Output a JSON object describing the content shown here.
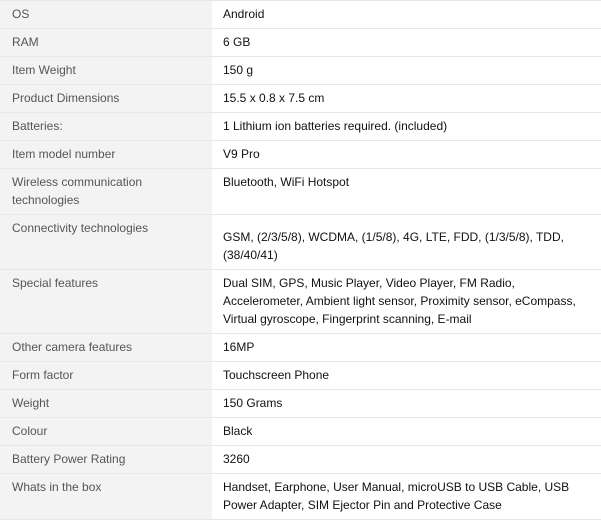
{
  "spec_table": {
    "rows": [
      {
        "label": "OS",
        "value": "Android"
      },
      {
        "label": "RAM",
        "value": "6 GB"
      },
      {
        "label": "Item Weight",
        "value": "150 g"
      },
      {
        "label": "Product Dimensions",
        "value": "15.5 x 0.8 x 7.5 cm"
      },
      {
        "label": "Batteries:",
        "value": "1 Lithium ion batteries required. (included)"
      },
      {
        "label": "Item model number",
        "value": "V9 Pro"
      },
      {
        "label": "Wireless communication technologies",
        "value": "Bluetooth, WiFi Hotspot"
      },
      {
        "label": "Connectivity technologies",
        "value": "GSM, (2/3/5/8), WCDMA, (1/5/8), 4G, LTE, FDD, (1/3/5/8), TDD, (38/40/41)"
      },
      {
        "label": "Special features",
        "value": "Dual SIM, GPS, Music Player, Video Player, FM Radio, Accelerometer, Ambient light sensor, Proximity sensor, eCompass, Virtual gyroscope, Fingerprint scanning, E-mail"
      },
      {
        "label": "Other camera features",
        "value": "16MP"
      },
      {
        "label": "Form factor",
        "value": "Touchscreen Phone"
      },
      {
        "label": "Weight",
        "value": "150 Grams"
      },
      {
        "label": "Colour",
        "value": "Black"
      },
      {
        "label": "Battery Power Rating",
        "value": "3260"
      },
      {
        "label": "Whats in the box",
        "value": "Handset, Earphone, User Manual, microUSB to USB Cable, USB Power Adapter, SIM Ejector Pin and Protective Case"
      }
    ]
  }
}
